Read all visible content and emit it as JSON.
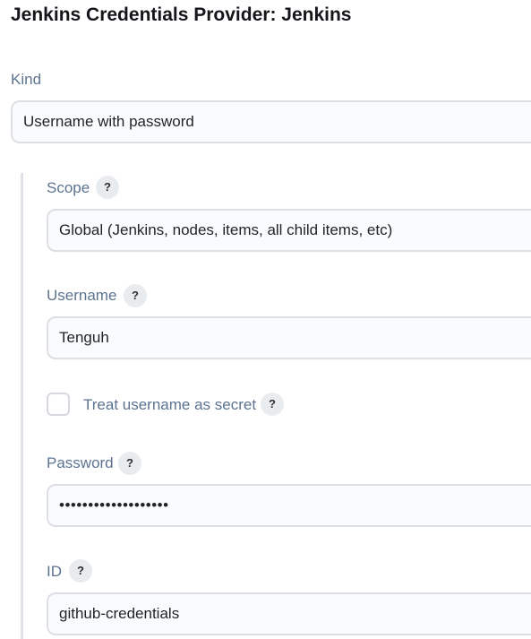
{
  "page": {
    "title": "Jenkins Credentials Provider: Jenkins"
  },
  "form": {
    "kind": {
      "label": "Kind",
      "value": "Username with password"
    },
    "scope": {
      "label": "Scope",
      "help": "?",
      "value": "Global (Jenkins, nodes, items, all child items, etc)"
    },
    "username": {
      "label": "Username",
      "help": "?",
      "value": "Tenguh"
    },
    "username_secret": {
      "label": "Treat username as secret",
      "help": "?",
      "checked": false
    },
    "password": {
      "label": "Password",
      "help": "?",
      "value": "•••••••••••••••••••"
    },
    "id": {
      "label": "ID",
      "help": "?",
      "value": "github-credentials"
    }
  }
}
